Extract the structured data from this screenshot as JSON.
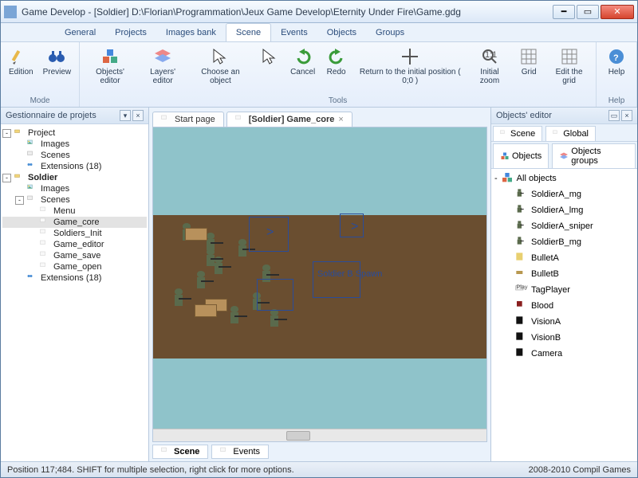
{
  "window": {
    "title": "Game Develop - [Soldier] D:\\Florian\\Programmation\\Jeux Game Develop\\Eternity Under Fire\\Game.gdg"
  },
  "menubar": {
    "items": [
      "General",
      "Projects",
      "Images bank",
      "Scene",
      "Events",
      "Objects",
      "Groups"
    ],
    "active_index": 3
  },
  "ribbon": {
    "groups": [
      {
        "label": "Mode",
        "buttons": [
          {
            "label": "Edition"
          },
          {
            "label": "Preview"
          }
        ]
      },
      {
        "label": "Tools",
        "buttons": [
          {
            "label": "Objects'\neditor"
          },
          {
            "label": "Layers'\neditor"
          },
          {
            "label": "Choose\nan object"
          },
          {
            "label": ""
          },
          {
            "label": "Cancel"
          },
          {
            "label": "Redo"
          },
          {
            "label": "Return to the initial\nposition ( 0;0 )"
          },
          {
            "label": "Initial\nzoom"
          },
          {
            "label": "Grid"
          },
          {
            "label": "Edit\nthe grid"
          }
        ]
      },
      {
        "label": "Help",
        "buttons": [
          {
            "label": "Help"
          }
        ]
      }
    ]
  },
  "project_panel": {
    "title": "Gestionnaire de projets",
    "nodes": [
      {
        "indent": 0,
        "toggle": "-",
        "icon": "folder",
        "label": "Project",
        "bold": false
      },
      {
        "indent": 1,
        "toggle": "",
        "icon": "images",
        "label": "Images"
      },
      {
        "indent": 1,
        "toggle": "",
        "icon": "scenes",
        "label": "Scenes"
      },
      {
        "indent": 1,
        "toggle": "",
        "icon": "ext",
        "label": "Extensions (18)"
      },
      {
        "indent": 0,
        "toggle": "-",
        "icon": "folder",
        "label": "Soldier",
        "bold": true
      },
      {
        "indent": 1,
        "toggle": "",
        "icon": "images",
        "label": "Images"
      },
      {
        "indent": 1,
        "toggle": "-",
        "icon": "scenes",
        "label": "Scenes"
      },
      {
        "indent": 2,
        "toggle": "",
        "icon": "scene",
        "label": "Menu"
      },
      {
        "indent": 2,
        "toggle": "",
        "icon": "scene",
        "label": "Game_core",
        "selected": true
      },
      {
        "indent": 2,
        "toggle": "",
        "icon": "scene",
        "label": "Soldiers_Init"
      },
      {
        "indent": 2,
        "toggle": "",
        "icon": "scene",
        "label": "Game_editor"
      },
      {
        "indent": 2,
        "toggle": "",
        "icon": "scene",
        "label": "Game_save"
      },
      {
        "indent": 2,
        "toggle": "",
        "icon": "scene",
        "label": "Game_open"
      },
      {
        "indent": 1,
        "toggle": "",
        "icon": "ext",
        "label": "Extensions (18)"
      }
    ]
  },
  "center": {
    "tabs": [
      {
        "label": "Start page",
        "closable": false
      },
      {
        "label": "[Soldier] Game_core",
        "closable": true,
        "active": true
      }
    ],
    "spawn_label": "Soldier B\nSpawn",
    "bottom_tabs": [
      {
        "label": "Scene",
        "active": true
      },
      {
        "label": "Events"
      }
    ]
  },
  "objects_panel": {
    "title": "Objects' editor",
    "scope_tabs": [
      "Scene",
      "Global"
    ],
    "sub_tabs": [
      "Objects",
      "Objects groups"
    ],
    "root": "All objects",
    "items": [
      {
        "icon": "soldier",
        "label": "SoldierA_mg"
      },
      {
        "icon": "soldier",
        "label": "SoldierA_lmg"
      },
      {
        "icon": "soldier",
        "label": "SoldierA_sniper"
      },
      {
        "icon": "soldier",
        "label": "SoldierB_mg"
      },
      {
        "icon": "bulletA",
        "label": "BulletA"
      },
      {
        "icon": "bulletB",
        "label": "BulletB"
      },
      {
        "icon": "tag",
        "label": "TagPlayer"
      },
      {
        "icon": "blood",
        "label": "Blood"
      },
      {
        "icon": "vision",
        "label": "VisionA"
      },
      {
        "icon": "vision",
        "label": "VisionB"
      },
      {
        "icon": "vision",
        "label": "Camera"
      }
    ]
  },
  "status": {
    "left": "Position 117;484. SHIFT for multiple selection, right click for more options.",
    "right": "2008-2010 Compil Games"
  }
}
